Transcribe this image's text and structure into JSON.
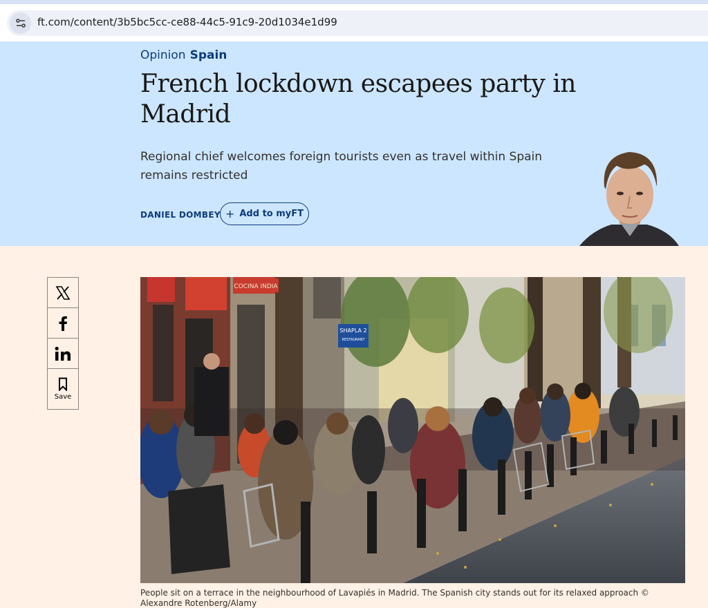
{
  "browser": {
    "url": "ft.com/content/3b5bc5cc-ce88-44c5-91c9-20d1034e1d99",
    "site_info_icon": "tune-icon"
  },
  "article": {
    "genre": "Opinion",
    "topic": "Spain",
    "headline": "French lockdown escapees party in Madrid",
    "standfirst": "Regional chief welcomes foreign tourists even as travel within Spain remains restricted",
    "author": "DANIEL DOMBEY",
    "myft_label": "Add to myFT",
    "caption": "People sit on a terrace in the neighbourhood of Lavapiés in Madrid. The Spanish city stands out for its relaxed approach © Alexandre Rotenberg/Alamy"
  },
  "share": {
    "items": [
      {
        "icon": "x-icon"
      },
      {
        "icon": "facebook-icon"
      },
      {
        "icon": "linkedin-icon"
      },
      {
        "icon": "bookmark-icon",
        "label": "Save"
      }
    ]
  },
  "photo_signs": {
    "sign1": "COCINA INDIA",
    "sign2": "SHAPLA 2",
    "sign3": "RESTAURANT"
  },
  "colors": {
    "hero_bg": "#cce6ff",
    "page_bg": "#fff1e5",
    "accent": "#0d3b78",
    "headline": "#1a1817"
  }
}
